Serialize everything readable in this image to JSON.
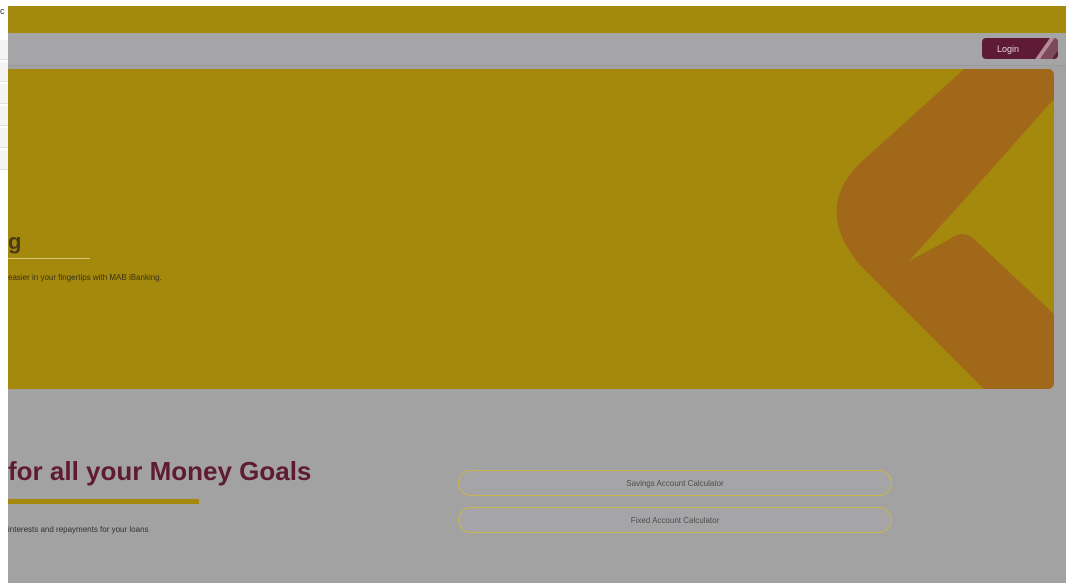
{
  "header": {
    "login_label": "Login"
  },
  "left_sliver": {
    "mark": "c"
  },
  "hero": {
    "title_fragment": "g",
    "text": "easier in your fingertips with MAB iBanking."
  },
  "goals": {
    "title": "for all your Money Goals",
    "subtitle": "interests and repayments for your loans",
    "buttons": [
      {
        "label": "Savings Account Calculator"
      },
      {
        "label": "Fixed Account Calculator"
      }
    ]
  },
  "colors": {
    "brand_maroon": "#5e1b33",
    "brand_yellow": "#a5890d",
    "hero_orange": "#a2681a",
    "overlay_gray": "#a3a2a3"
  },
  "icons": {
    "logo_chevron": "chevron-shape-icon"
  }
}
